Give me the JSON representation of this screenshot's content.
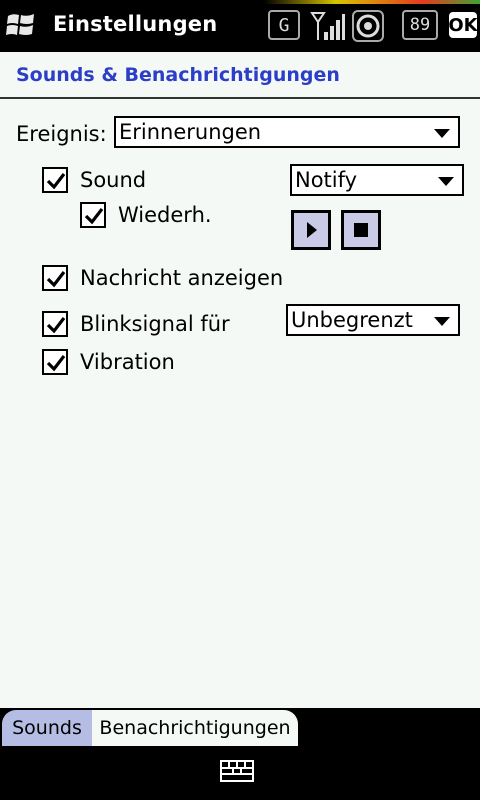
{
  "statusbar": {
    "title": "Einstellungen",
    "network_type": "G",
    "battery": "89",
    "ok_label": "OK",
    "icons": [
      "windows-start-icon",
      "network-g-icon",
      "signal-strength-icon",
      "disc-icon",
      "battery-icon"
    ]
  },
  "page": {
    "title": "Sounds & Benachrichtigungen"
  },
  "form": {
    "event_label": "Ereignis:",
    "event_value": "Erinnerungen",
    "sound": {
      "label": "Sound",
      "checked": true,
      "value": "Notify"
    },
    "repeat": {
      "label": "Wiederh.",
      "checked": true
    },
    "show_message": {
      "label": "Nachricht anzeigen",
      "checked": true
    },
    "flash": {
      "label": "Blinksignal für",
      "checked": true,
      "value": "Unbegrenzt"
    },
    "vibration": {
      "label": "Vibration",
      "checked": true
    }
  },
  "tabs": [
    {
      "label": "Sounds"
    },
    {
      "label": "Benachrichtigungen"
    }
  ],
  "colors": {
    "accent": "#2c3ec8",
    "background": "#f5f9f6",
    "button_fill": "#c9cbe6",
    "active_tab": "#b6bde4"
  }
}
